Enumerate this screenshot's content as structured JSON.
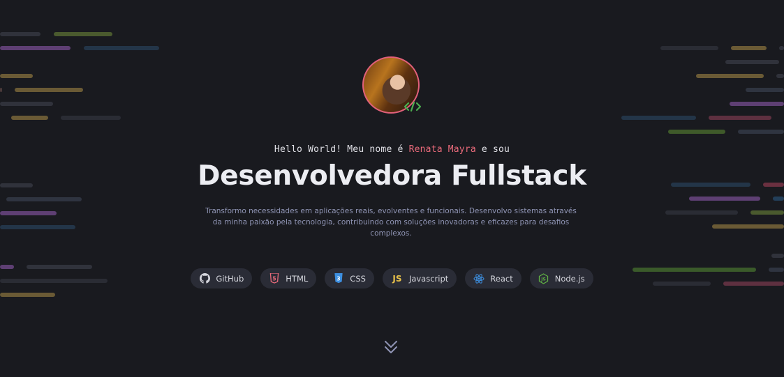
{
  "hero": {
    "greeting_prefix": "Hello World! Meu nome é ",
    "greeting_name": "Renata Mayra",
    "greeting_suffix": " e sou",
    "title": "Desenvolvedora Fullstack",
    "description": "Transformo necessidades em aplicações reais, evolventes e funcionais. Desenvolvo sistemas através da minha paixão pela tecnologia, contribuindo com soluções inovadoras e eficazes para desafios complexos."
  },
  "tags": [
    {
      "label": "GitHub",
      "icon": "github-icon"
    },
    {
      "label": "HTML",
      "icon": "html5-icon"
    },
    {
      "label": "CSS",
      "icon": "css3-icon"
    },
    {
      "label": "Javascript",
      "icon": "js-icon"
    },
    {
      "label": "React",
      "icon": "react-icon"
    },
    {
      "label": "Node.js",
      "icon": "nodejs-icon"
    }
  ],
  "colors": {
    "background": "#191a1f",
    "accent": "#e96a7a",
    "chip": "#2a2c36",
    "muted_text": "#8f94b4"
  }
}
